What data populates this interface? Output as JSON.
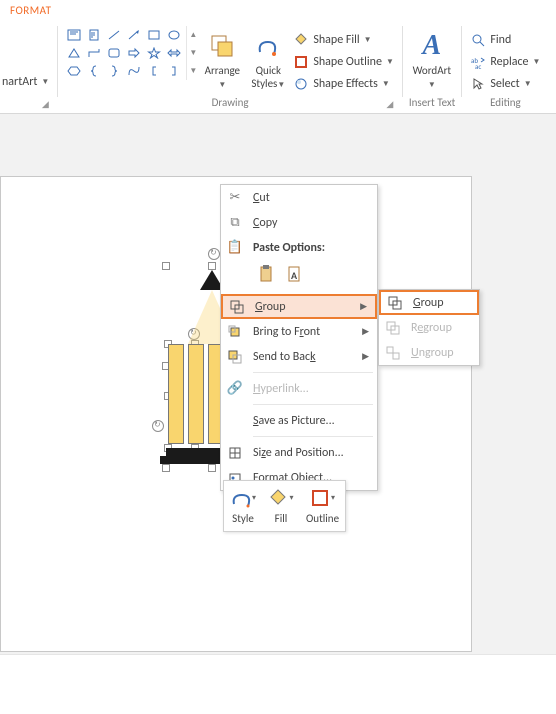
{
  "tab": {
    "format": "FORMAT"
  },
  "ribbon": {
    "arrange": "Arrange",
    "quick_styles": "Quick\nStyles",
    "shape_fill": "Shape Fill",
    "shape_outline": "Shape Outline",
    "shape_effects": "Shape Effects",
    "wordart": "WordArt",
    "find": "Find",
    "replace": "Replace",
    "select": "Select",
    "smartart": "nartArt",
    "group_drawing": "Drawing",
    "group_insert_text": "Insert Text",
    "group_editing": "Editing"
  },
  "ctx": {
    "cut": "Cut",
    "copy": "Copy",
    "paste_options": "Paste Options:",
    "group": "Group",
    "bring_front": "Bring to Front",
    "send_back": "Send to Back",
    "hyperlink": "Hyperlink...",
    "save_picture": "Save as Picture...",
    "size_position": "Size and Position...",
    "format_object": "Format Object..."
  },
  "sub": {
    "group": "Group",
    "regroup": "Regroup",
    "ungroup": "Ungroup"
  },
  "mini": {
    "style": "Style",
    "fill": "Fill",
    "outline": "Outline"
  }
}
